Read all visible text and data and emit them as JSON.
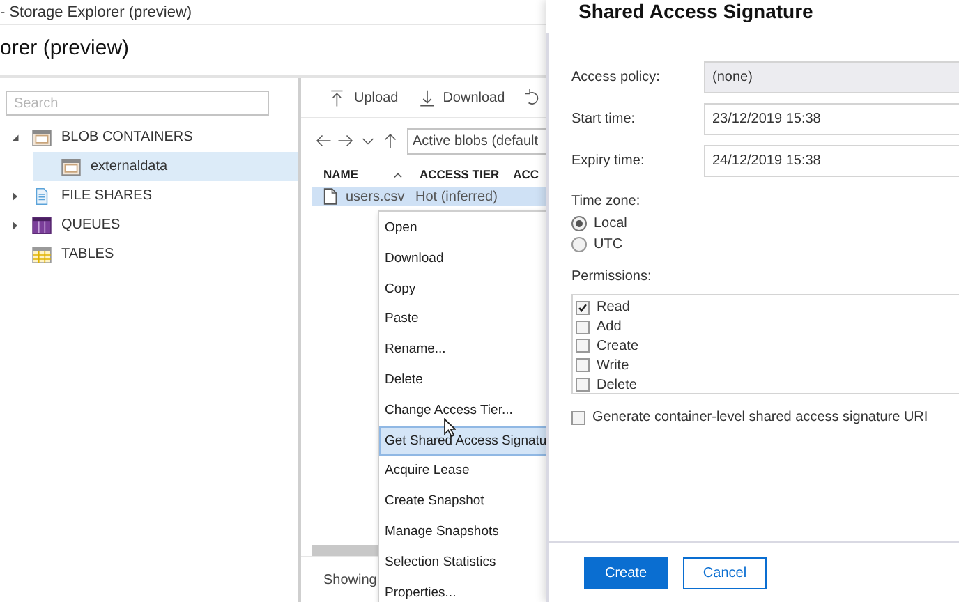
{
  "window": {
    "title": "- Storage Explorer (preview)"
  },
  "app_header": {
    "title": "orer (preview)"
  },
  "sidebar": {
    "search": {
      "placeholder": "Search"
    },
    "tree": [
      {
        "label": "BLOB CONTAINERS",
        "kind": "group",
        "expanded": true,
        "selected": false,
        "children": [
          {
            "label": "externaldata",
            "selected": true
          }
        ]
      },
      {
        "label": "FILE SHARES",
        "kind": "group",
        "expanded": false,
        "selected": false
      },
      {
        "label": "QUEUES",
        "kind": "group",
        "expanded": false,
        "selected": false
      },
      {
        "label": "TABLES",
        "kind": "leaf",
        "selected": false
      }
    ]
  },
  "toolbar": [
    {
      "label": "Upload"
    },
    {
      "label": "Download"
    }
  ],
  "navigation": {
    "filter": "Active blobs (default"
  },
  "table": {
    "columns": [
      "NAME",
      "ACCESS TIER",
      "ACC"
    ],
    "rows": [
      {
        "cells": [
          "users.csv",
          "Hot (inferred)"
        ],
        "selected": true
      }
    ]
  },
  "status_bar": {
    "text": "Showing"
  },
  "context_menu": {
    "items": [
      {
        "label": "Open",
        "selected": false
      },
      {
        "label": "Download",
        "selected": false
      },
      {
        "label": "Copy",
        "selected": false
      },
      {
        "label": "Paste",
        "selected": false
      },
      {
        "label": "Rename...",
        "selected": false
      },
      {
        "label": "Delete",
        "selected": false
      },
      {
        "label": "Change Access Tier...",
        "selected": false
      },
      {
        "label": "Get Shared Access Signatu",
        "selected": true
      },
      {
        "label": "Acquire Lease",
        "selected": false
      },
      {
        "label": "Create Snapshot",
        "selected": false
      },
      {
        "label": "Manage Snapshots",
        "selected": false
      },
      {
        "label": "Selection Statistics",
        "selected": false
      },
      {
        "label": "Properties...",
        "selected": false
      }
    ]
  },
  "dialog": {
    "title": "Shared Access Signature",
    "fields": [
      {
        "label": "Access policy:",
        "value": "(none)",
        "disabled": true
      },
      {
        "label": "Start time:",
        "value": "23/12/2019 15:38",
        "disabled": false
      },
      {
        "label": "Expiry time:",
        "value": "24/12/2019 15:38",
        "disabled": false
      }
    ],
    "time_zone": {
      "label": "Time zone:",
      "options": [
        {
          "label": "Local",
          "selected": true
        },
        {
          "label": "UTC",
          "selected": false
        }
      ]
    },
    "permissions": {
      "label": "Permissions:",
      "items": [
        {
          "label": "Read",
          "checked": true
        },
        {
          "label": "Add",
          "checked": false
        },
        {
          "label": "Create",
          "checked": false
        },
        {
          "label": "Write",
          "checked": false
        },
        {
          "label": "Delete",
          "checked": false
        }
      ]
    },
    "container_level": {
      "label": "Generate container-level shared access signature URI",
      "checked": false
    },
    "buttons": [
      {
        "label": "Create",
        "kind": "primary"
      },
      {
        "label": "Cancel",
        "kind": "secondary"
      }
    ]
  }
}
